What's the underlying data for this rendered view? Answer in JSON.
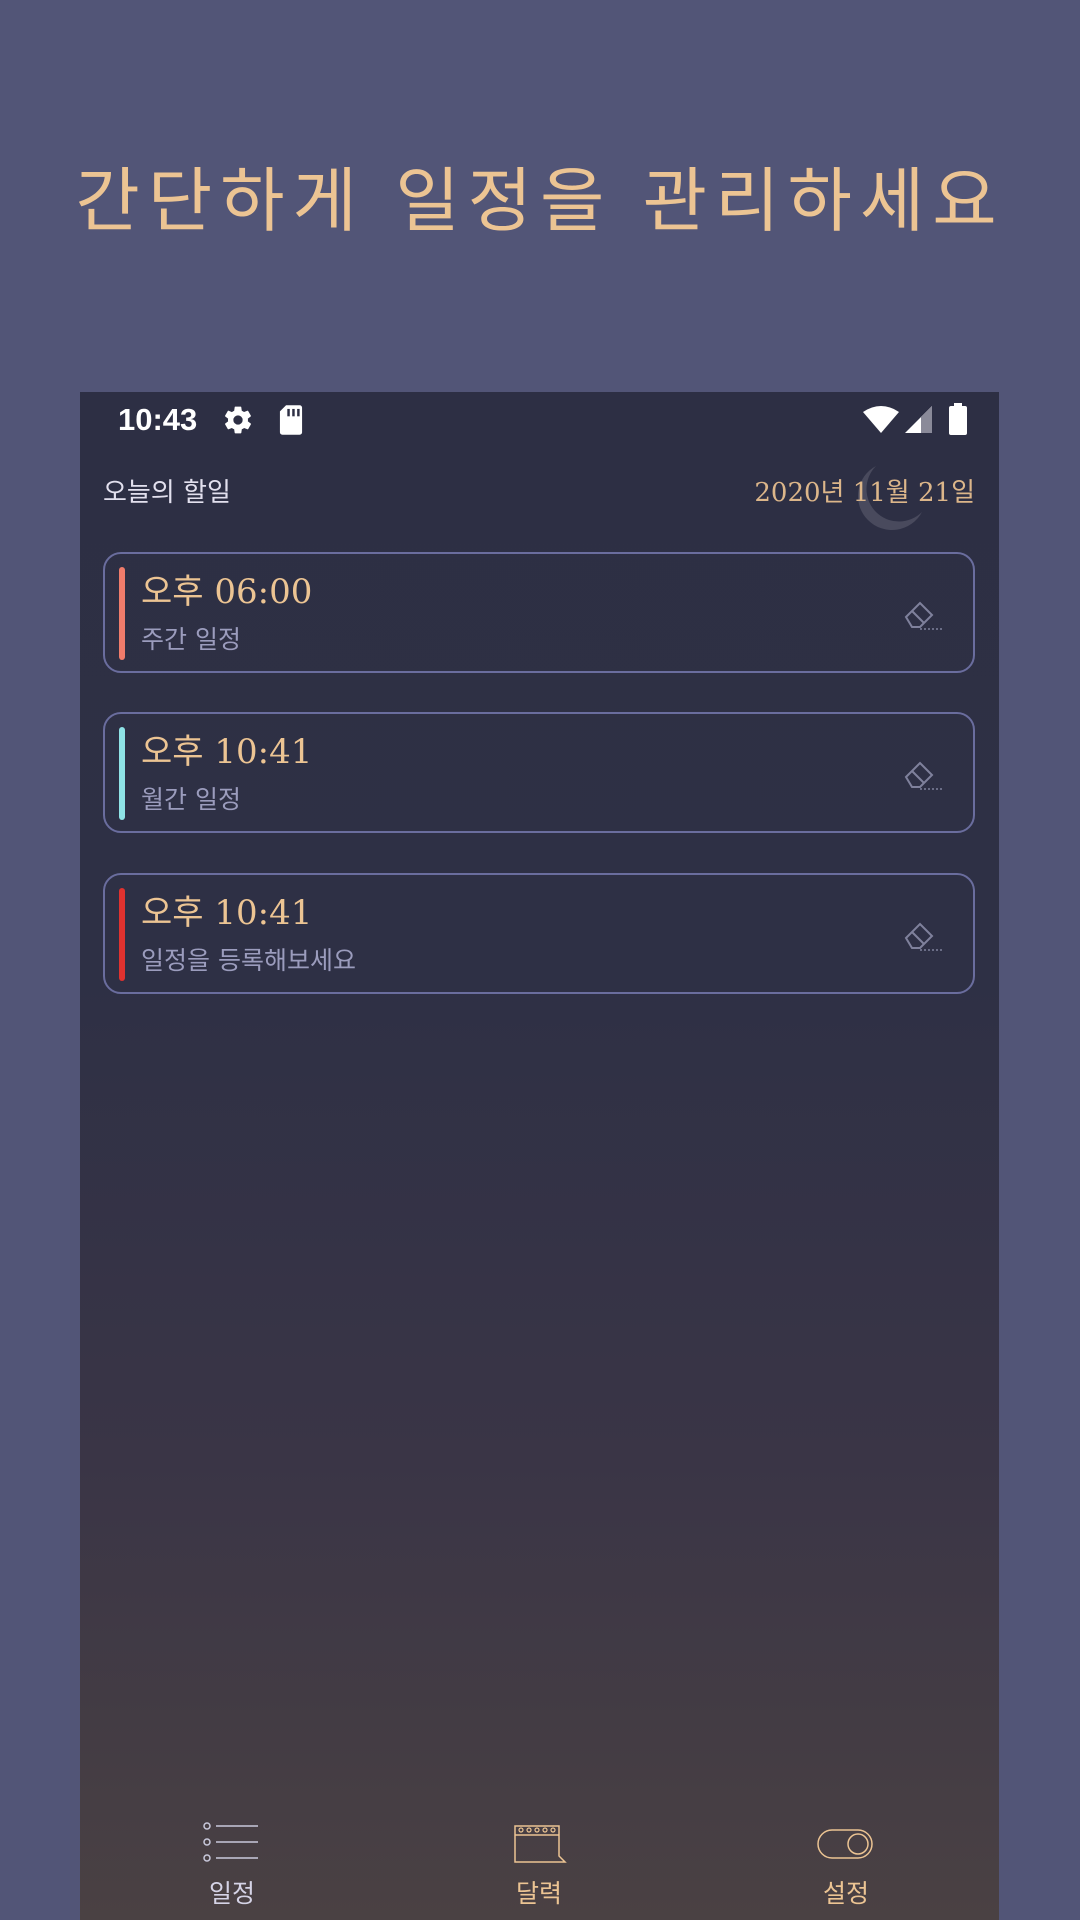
{
  "headline": "간단하게 일정을 관리하세요",
  "status_bar": {
    "time": "10:43",
    "icons": [
      "gear-icon",
      "sd-card-icon",
      "wifi-icon",
      "signal-icon",
      "battery-icon"
    ]
  },
  "header": {
    "title": "오늘의 할일",
    "date": "2020년 11월 21일"
  },
  "tasks": [
    {
      "time": "오후 06:00",
      "description": "주간 일정",
      "color": "#f07c6b"
    },
    {
      "time": "오후 10:41",
      "description": "월간 일정",
      "color": "#8fe3e6"
    },
    {
      "time": "오후 10:41",
      "description": "일정을 등록해보세요",
      "color": "#e0322f"
    }
  ],
  "bottom_nav": [
    {
      "label": "일정",
      "icon": "list-icon"
    },
    {
      "label": "달력",
      "icon": "calendar-icon"
    },
    {
      "label": "설정",
      "icon": "toggle-icon"
    }
  ],
  "colors": {
    "background": "#525577",
    "accent": "#ecc493",
    "card_border": "#6a6d9e",
    "phone_bg": "#2d2f44"
  }
}
